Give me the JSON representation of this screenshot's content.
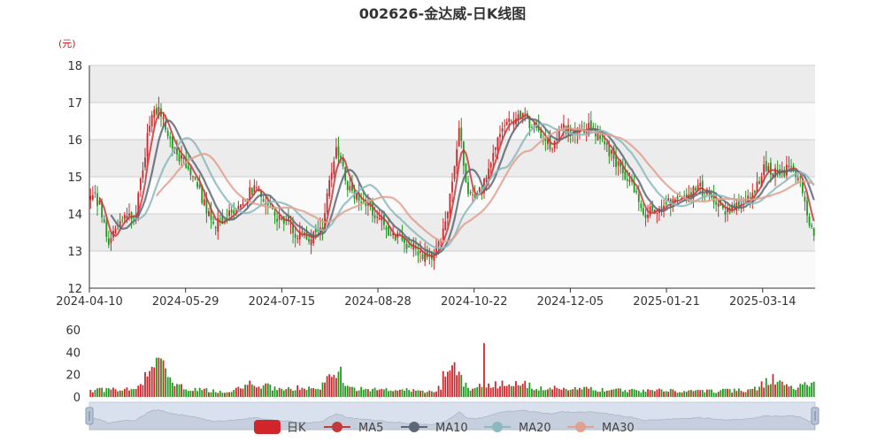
{
  "chart_data": {
    "type": "candlestick",
    "title": "002626-金达威-日K线图",
    "y_unit": "(元)",
    "x_tick_labels": [
      "2024-04-10",
      "2024-05-29",
      "2024-07-15",
      "2024-08-28",
      "2024-10-22",
      "2024-12-05",
      "2025-01-21",
      "2025-03-14"
    ],
    "price_axis": {
      "ylim": [
        12,
        18
      ],
      "ticks": [
        12,
        13,
        14,
        15,
        16,
        17,
        18
      ]
    },
    "volume_axis": {
      "ylim": [
        0,
        60
      ],
      "ticks": [
        0,
        20,
        40,
        60
      ]
    },
    "legend": [
      "日K",
      "MA5",
      "MA10",
      "MA20",
      "MA30"
    ],
    "colors": {
      "up": "#d0262b",
      "down": "#1f9a1f",
      "MA5": "#c43a3a",
      "MA10": "#5c6777",
      "MA20": "#8cb9bd",
      "MA30": "#e0a18f",
      "band": "#ececec",
      "axis": "#333333"
    },
    "close_key_points": [
      [
        0,
        14.5
      ],
      [
        4,
        14.3
      ],
      [
        8,
        13.2
      ],
      [
        14,
        13.8
      ],
      [
        20,
        14.0
      ],
      [
        26,
        16.5
      ],
      [
        30,
        16.9
      ],
      [
        36,
        15.8
      ],
      [
        42,
        15.3
      ],
      [
        48,
        14.6
      ],
      [
        54,
        13.7
      ],
      [
        60,
        13.9
      ],
      [
        66,
        14.3
      ],
      [
        72,
        14.7
      ],
      [
        78,
        14.2
      ],
      [
        84,
        13.8
      ],
      [
        90,
        13.5
      ],
      [
        96,
        13.3
      ],
      [
        102,
        13.7
      ],
      [
        108,
        15.8
      ],
      [
        114,
        14.6
      ],
      [
        120,
        14.4
      ],
      [
        126,
        13.9
      ],
      [
        132,
        13.5
      ],
      [
        138,
        13.2
      ],
      [
        144,
        13.0
      ],
      [
        150,
        12.8
      ],
      [
        154,
        13.2
      ],
      [
        158,
        14.5
      ],
      [
        162,
        16.3
      ],
      [
        166,
        14.5
      ],
      [
        172,
        14.6
      ],
      [
        178,
        15.9
      ],
      [
        184,
        16.5
      ],
      [
        190,
        16.7
      ],
      [
        196,
        16.2
      ],
      [
        202,
        15.8
      ],
      [
        208,
        16.3
      ],
      [
        214,
        16.2
      ],
      [
        220,
        16.4
      ],
      [
        226,
        15.9
      ],
      [
        232,
        15.3
      ],
      [
        238,
        14.8
      ],
      [
        244,
        14.0
      ],
      [
        250,
        14.2
      ],
      [
        256,
        14.3
      ],
      [
        262,
        14.5
      ],
      [
        268,
        14.7
      ],
      [
        274,
        14.3
      ],
      [
        280,
        14.1
      ],
      [
        286,
        14.2
      ],
      [
        292,
        14.6
      ],
      [
        296,
        15.2
      ],
      [
        302,
        15.1
      ],
      [
        308,
        15.2
      ],
      [
        312,
        14.9
      ],
      [
        316,
        13.7
      ],
      [
        318,
        13.4
      ]
    ],
    "volume_key_points": [
      [
        0,
        6
      ],
      [
        20,
        7
      ],
      [
        26,
        22
      ],
      [
        30,
        34
      ],
      [
        36,
        14
      ],
      [
        42,
        7
      ],
      [
        60,
        5
      ],
      [
        72,
        12
      ],
      [
        80,
        8
      ],
      [
        100,
        8
      ],
      [
        108,
        20
      ],
      [
        114,
        7
      ],
      [
        140,
        6
      ],
      [
        152,
        5
      ],
      [
        160,
        24
      ],
      [
        166,
        8
      ],
      [
        176,
        10
      ],
      [
        186,
        14
      ],
      [
        196,
        8
      ],
      [
        230,
        6
      ],
      [
        270,
        5
      ],
      [
        290,
        6
      ],
      [
        300,
        16
      ],
      [
        308,
        8
      ],
      [
        318,
        11
      ]
    ],
    "volume_spikes": [
      [
        29,
        35
      ],
      [
        30,
        35
      ],
      [
        110,
        27
      ],
      [
        155,
        23
      ],
      [
        160,
        31
      ],
      [
        173,
        48
      ]
    ]
  }
}
